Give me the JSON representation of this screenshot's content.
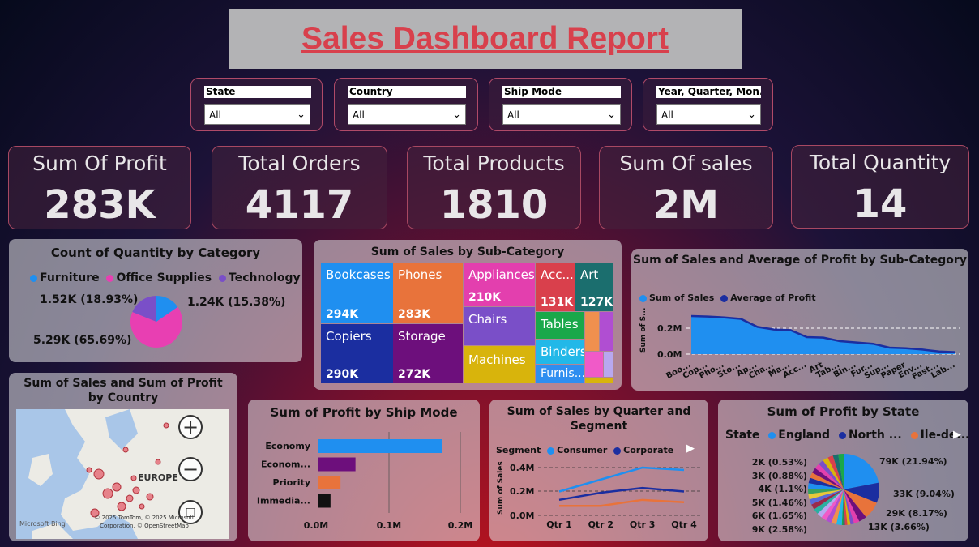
{
  "title": "Sales Dashboard Report",
  "slicers": [
    {
      "label": "State",
      "value": "All"
    },
    {
      "label": "Country",
      "value": "All"
    },
    {
      "label": "Ship Mode",
      "value": "All"
    },
    {
      "label": "Year, Quarter, Mon...",
      "value": "All"
    }
  ],
  "kpis": [
    {
      "label": "Sum Of Profit",
      "value": "283K"
    },
    {
      "label": "Total Orders",
      "value": "4117"
    },
    {
      "label": "Total Products",
      "value": "1810"
    },
    {
      "label": "Sum Of sales",
      "value": "2M"
    },
    {
      "label": "Total Quantity",
      "value": "14"
    }
  ],
  "pie_category": {
    "title": "Count of Quantity by Category",
    "legend": [
      "Furniture",
      "Office Supplies",
      "Technology"
    ],
    "labels": [
      "1.52K (18.93%)",
      "1.24K (15.38%)",
      "5.29K (65.69%)"
    ],
    "colors": [
      "#1f8ff0",
      "#e83fb2",
      "#7a4fc8"
    ]
  },
  "treemap": {
    "title": "Sum of Sales by Sub-Category",
    "items": [
      {
        "name": "Bookcases",
        "value": "294K",
        "color": "#1f8ff0"
      },
      {
        "name": "Copiers",
        "value": "290K",
        "color": "#1b2ea0"
      },
      {
        "name": "Phones",
        "value": "283K",
        "color": "#e8733b"
      },
      {
        "name": "Storage",
        "value": "272K",
        "color": "#6d0f7c"
      },
      {
        "name": "Appliances",
        "value": "210K",
        "color": "#e33fae"
      },
      {
        "name": "Chairs",
        "value": "",
        "color": "#7a4fc8"
      },
      {
        "name": "Machines",
        "value": "",
        "color": "#d8b40c"
      },
      {
        "name": "Acc...",
        "value": "131K",
        "color": "#d9404c"
      },
      {
        "name": "Art",
        "value": "127K",
        "color": "#1b6e6e"
      },
      {
        "name": "Tables",
        "value": "",
        "color": "#1aa84a"
      },
      {
        "name": "Binders",
        "value": "",
        "color": "#22b8e8"
      },
      {
        "name": "Furnis...",
        "value": "",
        "color": "#2e8ef0"
      }
    ]
  },
  "line_subcat": {
    "title": "Sum of Sales and Average of Profit by Sub-Category",
    "legend": [
      "Sum of Sales",
      "Average of Profit"
    ],
    "ylabel": "Sum of S...",
    "yticks": [
      "0.2M",
      "0.0M"
    ],
    "categories": [
      "Boo...",
      "Cop...",
      "Pho...",
      "Sto...",
      "Ap...",
      "Cha...",
      "Ma...",
      "Acc...",
      "Art",
      "Tab...",
      "Bin...",
      "Fur...",
      "Sup...",
      "Paper",
      "Env...",
      "Fast...",
      "Lab..."
    ]
  },
  "map": {
    "title": "Sum of Sales and Sum of Profit by Country",
    "region_label": "EUROPE",
    "attribution": "© 2025 TomTom, © 2025 Microsoft Corporation, © OpenStreetMap",
    "brand": "Microsoft Bing",
    "zoom_in": "+",
    "zoom_out": "−"
  },
  "bar_shipmode": {
    "title": "Sum of Profit by Ship Mode",
    "categories": [
      "Economy",
      "Econom...",
      "Priority",
      "Immedia..."
    ],
    "xticks": [
      "0.0M",
      "0.1M",
      "0.2M"
    ]
  },
  "line_quarter": {
    "title": "Sum of Sales by Quarter and Segment",
    "legend_title": "Segment",
    "legend": [
      "Consumer",
      "Corporate"
    ],
    "ylabel": "Sum of Sales",
    "yticks": [
      "0.4M",
      "0.2M",
      "0.0M"
    ],
    "xticks": [
      "Qtr 1",
      "Qtr 2",
      "Qtr 3",
      "Qtr 4"
    ]
  },
  "pie_state": {
    "title": "Sum of Profit by State",
    "legend_title": "State",
    "legend": [
      "England",
      "North ...",
      "Ile-de..."
    ],
    "labels_left": [
      "2K (0.53%)",
      "3K (0.88%)",
      "4K (1.1%)",
      "5K (1.46%)",
      "6K (1.65%)",
      "9K (2.58%)"
    ],
    "labels_right": [
      "79K (21.94%)",
      "33K (9.04%)",
      "29K (8.17%)",
      "13K (3.66%)"
    ]
  },
  "chart_data": [
    {
      "type": "pie",
      "title": "Count of Quantity by Category",
      "categories": [
        "Furniture",
        "Office Supplies",
        "Technology"
      ],
      "values": [
        1240,
        5290,
        1520
      ],
      "percent": [
        15.38,
        65.69,
        18.93
      ]
    },
    {
      "type": "treemap",
      "title": "Sum of Sales by Sub-Category",
      "categories": [
        "Bookcases",
        "Copiers",
        "Phones",
        "Storage",
        "Appliances",
        "Acc...",
        "Art"
      ],
      "values": [
        294000,
        290000,
        283000,
        272000,
        210000,
        131000,
        127000
      ]
    },
    {
      "type": "area",
      "title": "Sum of Sales and Average of Profit by Sub-Category",
      "categories": [
        "Boo...",
        "Cop...",
        "Pho...",
        "Sto...",
        "Ap...",
        "Cha...",
        "Ma...",
        "Acc...",
        "Art",
        "Tab...",
        "Bin...",
        "Fur...",
        "Sup...",
        "Paper",
        "Env...",
        "Fast...",
        "Lab..."
      ],
      "series": [
        {
          "name": "Sum of Sales",
          "values": [
            0.294,
            0.29,
            0.283,
            0.272,
            0.21,
            0.19,
            0.185,
            0.131,
            0.127,
            0.1,
            0.09,
            0.08,
            0.05,
            0.045,
            0.035,
            0.02,
            0.015
          ]
        },
        {
          "name": "Average of Profit",
          "values": [
            0.001,
            0.001,
            0.001,
            0.001,
            0.001,
            0.001,
            0.001,
            0.001,
            0.001,
            0.001,
            0.001,
            0.001,
            0.001,
            0.001,
            0.001,
            0.001,
            0.001
          ]
        }
      ],
      "ylabel": "Sum of S...",
      "ylim": [
        0,
        0.3
      ]
    },
    {
      "type": "bar",
      "title": "Sum of Profit by Ship Mode",
      "categories": [
        "Economy",
        "Econom...",
        "Priority",
        "Immedia..."
      ],
      "values": [
        0.175,
        0.053,
        0.032,
        0.018
      ],
      "xlim": [
        0,
        0.2
      ]
    },
    {
      "type": "line",
      "title": "Sum of Sales by Quarter and Segment",
      "categories": [
        "Qtr 1",
        "Qtr 2",
        "Qtr 3",
        "Qtr 4"
      ],
      "series": [
        {
          "name": "Consumer",
          "values": [
            0.2,
            0.3,
            0.4,
            0.38
          ]
        },
        {
          "name": "Corporate",
          "values": [
            0.13,
            0.19,
            0.23,
            0.2
          ]
        },
        {
          "name": "",
          "values": [
            0.08,
            0.08,
            0.13,
            0.11
          ]
        }
      ],
      "ylabel": "Sum of Sales",
      "ylim": [
        0,
        0.4
      ]
    },
    {
      "type": "pie",
      "title": "Sum of Profit by State",
      "values": [
        79,
        33,
        29,
        13,
        9,
        6,
        5,
        4,
        3,
        2
      ],
      "percent": [
        21.94,
        9.04,
        8.17,
        3.66,
        2.58,
        1.65,
        1.46,
        1.1,
        0.88,
        0.53
      ]
    }
  ]
}
